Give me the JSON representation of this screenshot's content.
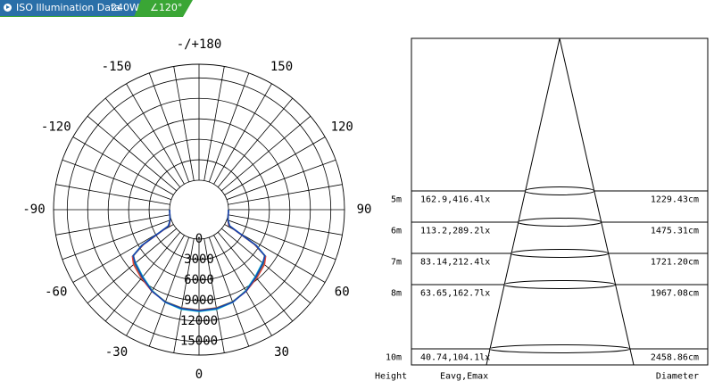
{
  "banner": {
    "title": "ISO Illumination Data",
    "power": "240W",
    "beam_angle": "∠120°",
    "colors": {
      "blue": "#2a6fa8",
      "green": "#3aa635"
    }
  },
  "chart_data": [
    {
      "type": "polar",
      "angle_labels": [
        {
          "deg": 180,
          "label": "-/+180"
        },
        {
          "deg": 150,
          "label": "150"
        },
        {
          "deg": -150,
          "label": "-150"
        },
        {
          "deg": 120,
          "label": "120"
        },
        {
          "deg": -120,
          "label": "-120"
        },
        {
          "deg": 90,
          "label": "90"
        },
        {
          "deg": -90,
          "label": "-90"
        },
        {
          "deg": 60,
          "label": "60"
        },
        {
          "deg": -60,
          "label": "-60"
        },
        {
          "deg": 30,
          "label": "30"
        },
        {
          "deg": -30,
          "label": "-30"
        },
        {
          "deg": 0,
          "label": "0"
        }
      ],
      "radial_ticks": [
        "0",
        "3000",
        "6000",
        "9000",
        "12000",
        "15000"
      ],
      "radial_values": [
        0,
        3000,
        6000,
        9000,
        12000,
        15000
      ],
      "rmax": 17000,
      "angle_step": 10,
      "series": [
        {
          "color": "#e53935",
          "points": [
            [
              0,
              10400
            ],
            [
              10,
              10300
            ],
            [
              20,
              10050
            ],
            [
              30,
              9500
            ],
            [
              40,
              8800
            ],
            [
              50,
              8200
            ],
            [
              55,
              7600
            ],
            [
              58,
              5200
            ],
            [
              60,
              2000
            ],
            [
              62,
              600
            ],
            [
              70,
              200
            ],
            [
              90,
              0
            ]
          ]
        },
        {
          "color": "#00bcd4",
          "points": [
            [
              0,
              10600
            ],
            [
              10,
              10500
            ],
            [
              20,
              10150
            ],
            [
              30,
              9400
            ],
            [
              40,
              8500
            ],
            [
              50,
              7800
            ],
            [
              55,
              7500
            ],
            [
              58,
              5600
            ],
            [
              60,
              2500
            ],
            [
              62,
              800
            ],
            [
              70,
              200
            ],
            [
              90,
              0
            ]
          ]
        },
        {
          "color": "#43a047",
          "points": [
            [
              0,
              10450
            ],
            [
              10,
              10350
            ],
            [
              20,
              10050
            ],
            [
              30,
              9450
            ],
            [
              40,
              8650
            ],
            [
              50,
              8000
            ],
            [
              55,
              7400
            ],
            [
              58,
              5400
            ],
            [
              60,
              2200
            ],
            [
              62,
              700
            ],
            [
              70,
              200
            ],
            [
              90,
              0
            ]
          ]
        },
        {
          "color": "#1e3fb0",
          "points": [
            [
              0,
              10500
            ],
            [
              10,
              10400
            ],
            [
              20,
              10100
            ],
            [
              30,
              9480
            ],
            [
              40,
              8600
            ],
            [
              50,
              7900
            ],
            [
              55,
              7450
            ],
            [
              58,
              5500
            ],
            [
              60,
              2300
            ],
            [
              62,
              750
            ],
            [
              70,
              200
            ],
            [
              90,
              0
            ]
          ]
        }
      ]
    },
    {
      "type": "table",
      "columns": [
        "Height",
        "Eavg,Emax",
        "Diameter"
      ],
      "rows": [
        {
          "height": "5m",
          "eavg_emax": "162.9,416.4lx",
          "diameter": "1229.43cm",
          "h_m": 5
        },
        {
          "height": "6m",
          "eavg_emax": "113.2,289.2lx",
          "diameter": "1475.31cm",
          "h_m": 6
        },
        {
          "height": "7m",
          "eavg_emax": "83.14,212.4lx",
          "diameter": "1721.20cm",
          "h_m": 7
        },
        {
          "height": "8m",
          "eavg_emax": "63.65,162.7lx",
          "diameter": "1967.08cm",
          "h_m": 8
        },
        {
          "height": "10m",
          "eavg_emax": "40.74,104.1lx",
          "diameter": "2458.86cm",
          "h_m": 10
        }
      ]
    }
  ]
}
